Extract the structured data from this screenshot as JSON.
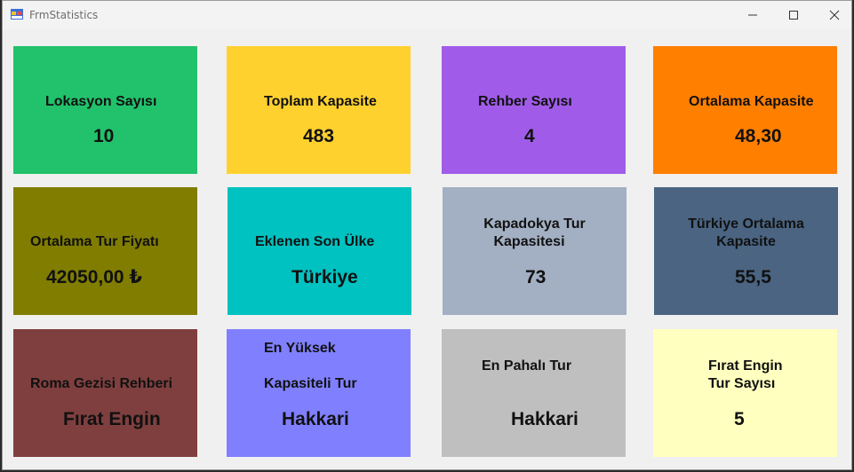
{
  "window": {
    "title": "FrmStatistics",
    "icons": {
      "app": "form-icon",
      "minimize": "minimize-icon",
      "maximize": "maximize-icon",
      "close": "close-icon"
    }
  },
  "tiles": [
    {
      "label": "Lokasyon Sayısı",
      "value": "10",
      "color": "#21c26b"
    },
    {
      "label": "Toplam Kapasite",
      "value": "483",
      "color": "#ffd12f"
    },
    {
      "label": "Rehber Sayısı",
      "value": "4",
      "color": "#a05ce8"
    },
    {
      "label": "Ortalama Kapasite",
      "value": "48,30",
      "color": "#ff7f00"
    },
    {
      "label": "Ortalama Tur Fiyatı",
      "value": "42050,00 ₺",
      "color": "#807d00"
    },
    {
      "label": "Eklenen Son Ülke",
      "value": "Türkiye",
      "color": "#00c2c1"
    },
    {
      "label_line1": "Kapadokya Tur",
      "label_line2": "Kapasitesi",
      "value": "73",
      "color": "#a3afc2"
    },
    {
      "label_line1": "Türkiye Ortalama",
      "label_line2": "Kapasite",
      "value": "55,5",
      "color": "#4a6482"
    },
    {
      "label": "Roma Gezisi Rehberi",
      "value": "Fırat Engin",
      "color": "#7f3f3f"
    },
    {
      "label_line1": "En Yüksek",
      "label_line2": "Kapasiteli Tur",
      "value": "Hakkari",
      "color": "#8080ff"
    },
    {
      "label": "En Pahalı Tur",
      "value": "Hakkari",
      "color": "#bfbfbf"
    },
    {
      "label_line1": "Fırat Engin",
      "label_line2": "Tur Sayısı",
      "value": "5",
      "color": "#ffffc0"
    }
  ]
}
